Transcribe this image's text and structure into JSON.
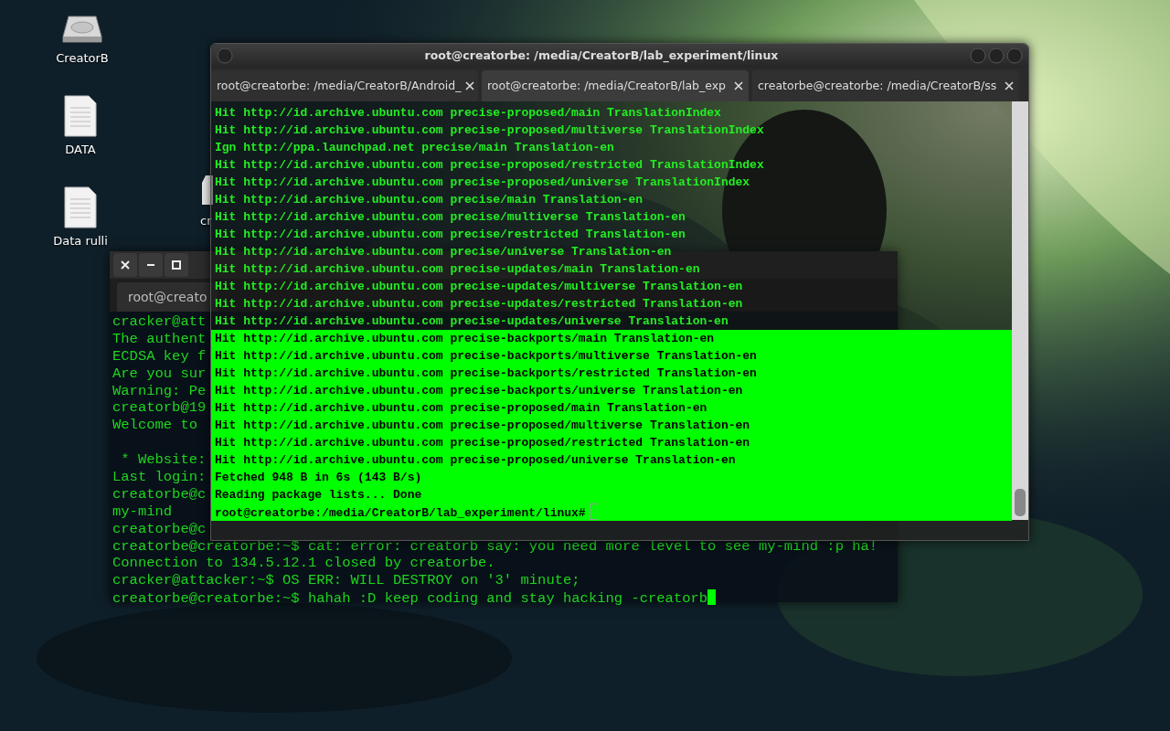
{
  "desktop_icons": [
    {
      "kind": "drive",
      "label": "CreatorB"
    },
    {
      "kind": "document",
      "label": "DATA"
    },
    {
      "kind": "document",
      "label": "Data rulli"
    },
    {
      "kind": "partial",
      "label": "cr"
    }
  ],
  "back_terminal": {
    "tabs": [
      {
        "label": "root@creato",
        "selected": true
      }
    ],
    "lines": [
      {
        "text": "cracker@att"
      },
      {
        "text": "The authent"
      },
      {
        "text": "ECDSA key f"
      },
      {
        "text": "Are you sur"
      },
      {
        "text": "Warning: Pe"
      },
      {
        "text": "creatorb@19"
      },
      {
        "text": "Welcome to"
      },
      {
        "kind": "blank"
      },
      {
        "text": " * Website:"
      },
      {
        "text": "Last login:"
      },
      {
        "text": "creatorbe@c"
      },
      {
        "text": "my-mind"
      },
      {
        "text": "creatorbe@c"
      },
      {
        "text": "creatorbe@creatorbe:~$ cat: error: creatorb say: you need more level to see my-mind :p ha!"
      },
      {
        "text": "Connection to 134.5.12.1 closed by creatorbe."
      },
      {
        "text": "cracker@attacker:~$ OS ERR: WILL DESTROY on '3' minute;"
      },
      {
        "text": "creatorbe@creatorbe:~$ hahah :D keep coding and stay hacking -creatorb",
        "cursor": true
      }
    ]
  },
  "front_terminal": {
    "title": "root@creatorbe: /media/CreatorB/lab_experiment/linux",
    "tabs": [
      {
        "label": "root@creatorbe: /media/CreatorB/Android_",
        "selected": false
      },
      {
        "label": "root@creatorbe: /media/CreatorB/lab_exp",
        "selected": true
      },
      {
        "label": "creatorbe@creatorbe: /media/CreatorB/ss",
        "selected": false
      }
    ],
    "lines": [
      {
        "text": "Hit http://id.archive.ubuntu.com precise-proposed/main TranslationIndex",
        "selected": false
      },
      {
        "text": "Hit http://id.archive.ubuntu.com precise-proposed/multiverse TranslationIndex",
        "selected": false
      },
      {
        "text": "Ign http://ppa.launchpad.net precise/main Translation-en",
        "selected": false
      },
      {
        "text": "Hit http://id.archive.ubuntu.com precise-proposed/restricted TranslationIndex",
        "selected": false
      },
      {
        "text": "Hit http://id.archive.ubuntu.com precise-proposed/universe TranslationIndex",
        "selected": false
      },
      {
        "text": "Hit http://id.archive.ubuntu.com precise/main Translation-en",
        "selected": false
      },
      {
        "text": "Hit http://id.archive.ubuntu.com precise/multiverse Translation-en",
        "selected": false
      },
      {
        "text": "Hit http://id.archive.ubuntu.com precise/restricted Translation-en",
        "selected": false
      },
      {
        "text": "Hit http://id.archive.ubuntu.com precise/universe Translation-en",
        "selected": false
      },
      {
        "text": "Hit http://id.archive.ubuntu.com precise-updates/main Translation-en",
        "selected": false
      },
      {
        "text": "Hit http://id.archive.ubuntu.com precise-updates/multiverse Translation-en",
        "selected": false
      },
      {
        "text": "Hit http://id.archive.ubuntu.com precise-updates/restricted Translation-en",
        "selected": false
      },
      {
        "text": "Hit http://id.archive.ubuntu.com precise-updates/universe Translation-en",
        "selected": false
      },
      {
        "text": "Hit http://id.archive.ubuntu.com precise-backports/main Translation-en",
        "selected": true
      },
      {
        "text": "Hit http://id.archive.ubuntu.com precise-backports/multiverse Translation-en",
        "selected": true
      },
      {
        "text": "Hit http://id.archive.ubuntu.com precise-backports/restricted Translation-en",
        "selected": true
      },
      {
        "text": "Hit http://id.archive.ubuntu.com precise-backports/universe Translation-en",
        "selected": true
      },
      {
        "text": "Hit http://id.archive.ubuntu.com precise-proposed/main Translation-en",
        "selected": true
      },
      {
        "text": "Hit http://id.archive.ubuntu.com precise-proposed/multiverse Translation-en",
        "selected": true
      },
      {
        "text": "Hit http://id.archive.ubuntu.com precise-proposed/restricted Translation-en",
        "selected": true
      },
      {
        "text": "Hit http://id.archive.ubuntu.com precise-proposed/universe Translation-en",
        "selected": true
      },
      {
        "text": "Fetched 948 B in 6s (143 B/s)",
        "selected": true
      },
      {
        "text": "Reading package lists... Done",
        "selected": true
      },
      {
        "text": "root@creatorbe:/media/CreatorB/lab_experiment/linux#",
        "selected": true,
        "cursor": true
      }
    ]
  }
}
